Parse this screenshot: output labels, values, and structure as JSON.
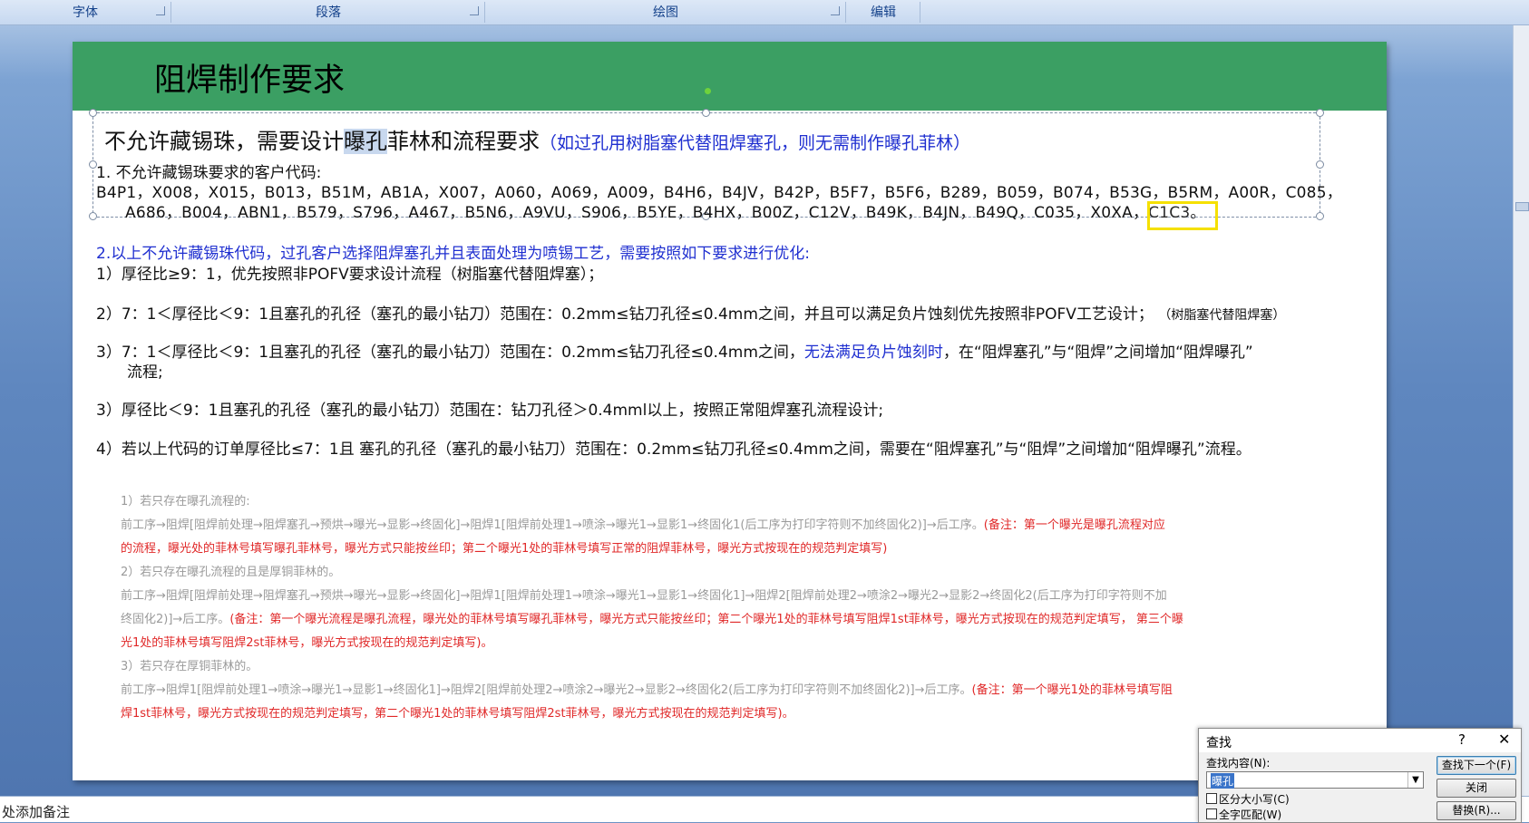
{
  "ribbon": {
    "groups": [
      {
        "label": "字体"
      },
      {
        "label": "段落"
      },
      {
        "label": "绘图"
      },
      {
        "label": "编辑"
      }
    ]
  },
  "slide": {
    "title": "阻焊制作要求",
    "heading_pre": "不允许藏锡珠，需要设计",
    "heading_match": "曝孔",
    "heading_post": "菲林和流程要求",
    "heading_note": "（如过孔用树脂塞代替阻焊塞孔，则无需制作曝孔菲林）",
    "item1": "1.    不允许藏锡珠要求的客户代码:",
    "codes_line1": "B4P1，X008，X015，B013，B51M，AB1A，X007，A060，A069，A009，B4H6，B4JV，B42P，B5F7，B5F6，B289，B059，B074，B53G，B5RM，A00R，C085，",
    "codes_line2": "A686，B004，ABN1，B579，S796，A467，B5N6，A9VU，S906，B5YE，B4HX，B00Z，C12V，B49K，B4JN，B49Q，C035，X0XA，C1C3。",
    "item2": "2.以上不允许藏锡珠代码，过孔客户选择阻焊塞孔并且表面处理为喷锡工艺，需要按照如下要求进行优化:",
    "rule1": "1）厚径比≥9：1，优先按照非POFV要求设计流程（树脂塞代替阻焊塞）；",
    "rule2": "2）7：1＜厚径比＜9：1且塞孔的孔径（塞孔的最小钻刀）范围在：0.2mm≤钻刀孔径≤0.4mm之间，并且可以满足负片蚀刻优先按照非POFV工艺设计；",
    "rule2_note": "（树脂塞代替阻焊塞）",
    "rule3a_pre": "3）7：1＜厚径比＜9：1且塞孔的孔径（塞孔的最小钻刀）范围在：0.2mm≤钻刀孔径≤0.4mm之间，",
    "rule3a_blue": "无法满足负片蚀刻时",
    "rule3a_post": "，在“阻焊塞孔”与“阻焊”之间增加“阻焊曝孔”",
    "rule3a_cont": "流程;",
    "rule3b": "3）厚径比＜9：1且塞孔的孔径（塞孔的最小钻刀）范围在：钻刀孔径＞0.4mml以上，按照正常阻焊塞孔流程设计;",
    "rule4": "4）若以上代码的订单厚径比≤7：1且 塞孔的孔径（塞孔的最小钻刀）范围在：0.2mm≤钻刀孔径≤0.4mm之间，需要在“阻焊塞孔”与“阻焊”之间增加“阻焊曝孔”流程。"
  },
  "embedded": {
    "l1": "1）若只存在曝孔流程的:",
    "l2": "前工序→阻焊[阻焊前处理→阻焊塞孔→预烘→曝光→显影→终固化]→阻焊1[阻焊前处理1→喷涂→曝光1→显影1→终固化1(后工序为打印字符则不加终固化2)]→后工序。",
    "l2_red": "(备注：第一个曝光是曝孔流程对应",
    "l3_red": "的流程，曝光处的菲林号填写曝孔菲林号，曝光方式只能按丝印；第二个曝光1处的菲林号填写正常的阻焊菲林号，曝光方式按现在的规范判定填写)",
    "l4": "2）若只存在曝孔流程的且是厚铜菲林的。",
    "l5": "前工序→阻焊[阻焊前处理→阻焊塞孔→预烘→曝光→显影→终固化]→阻焊1[阻焊前处理1→喷涂→曝光1→显影1→终固化1]→阻焊2[阻焊前处理2→喷涂2→曝光2→显影2→终固化2(后工序为打印字符则不加",
    "l6": "终固化2)]→后工序。",
    "l6_red": "(备注：第一个曝光流程是曝孔流程，曝光处的菲林号填写曝孔菲林号，曝光方式只能按丝印；第二个曝光1处的菲林号填写阻焊1st菲林号，曝光方式按现在的规范判定填写，  第三个曝",
    "l7_red": "光1处的菲林号填写阻焊2st菲林号，曝光方式按现在的规范判定填写)。",
    "l8": "3）若只存在厚铜菲林的。",
    "l9": "前工序→阻焊1[阻焊前处理1→喷涂→曝光1→显影1→终固化1]→阻焊2[阻焊前处理2→喷涂2→曝光2→显影2→终固化2(后工序为打印字符则不加终固化2)]→后工序。",
    "l9_red": "(备注：第一个曝光1处的菲林号填写阻",
    "l10_red": "焊1st菲林号，曝光方式按现在的规范判定填写，第二个曝光1处的菲林号填写阻焊2st菲林号，曝光方式按现在的规范判定填写)。"
  },
  "notes": {
    "placeholder": "处添加备注"
  },
  "find_dialog": {
    "title": "查找",
    "help": "?",
    "close": "✕",
    "find_label": "查找内容(N):",
    "find_value": "曝孔",
    "find_next": "查找下一个(F)",
    "close_btn": "关闭",
    "replace_btn": "替换(R)...",
    "match_case": "区分大小写(C)",
    "whole_word": "全字匹配(W)"
  }
}
